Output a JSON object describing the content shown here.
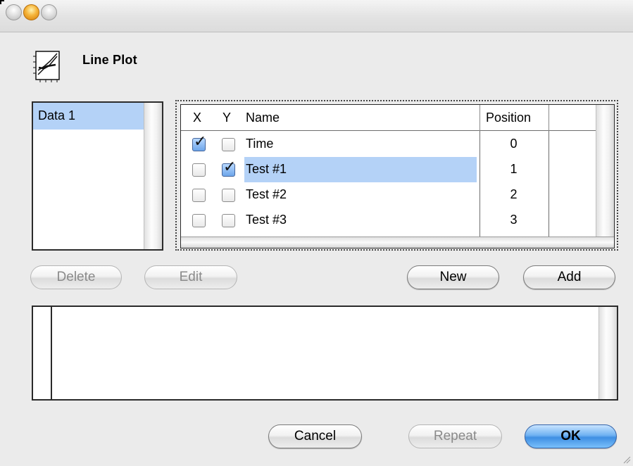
{
  "window": {
    "title": ""
  },
  "header": {
    "icon": "line-plot-icon",
    "title": "Line Plot"
  },
  "data_list": {
    "items": [
      {
        "label": "Data 1",
        "selected": true
      }
    ]
  },
  "table": {
    "columns": [
      "X",
      "Y",
      "Name",
      "Position"
    ],
    "rows": [
      {
        "x": true,
        "y": false,
        "name": "Time",
        "position": "0",
        "selected": false
      },
      {
        "x": false,
        "y": true,
        "name": "Test #1",
        "position": "1",
        "selected": true
      },
      {
        "x": false,
        "y": false,
        "name": "Test #2",
        "position": "2",
        "selected": false
      },
      {
        "x": false,
        "y": false,
        "name": "Test #3",
        "position": "3",
        "selected": false
      }
    ]
  },
  "buttons": {
    "delete": "Delete",
    "edit": "Edit",
    "new": "New",
    "add": "Add",
    "cancel": "Cancel",
    "repeat": "Repeat",
    "ok": "OK"
  },
  "colors": {
    "selection": "#b4d2f7",
    "primary_button": "#4a97e6",
    "minimize": "#f5b43a"
  }
}
